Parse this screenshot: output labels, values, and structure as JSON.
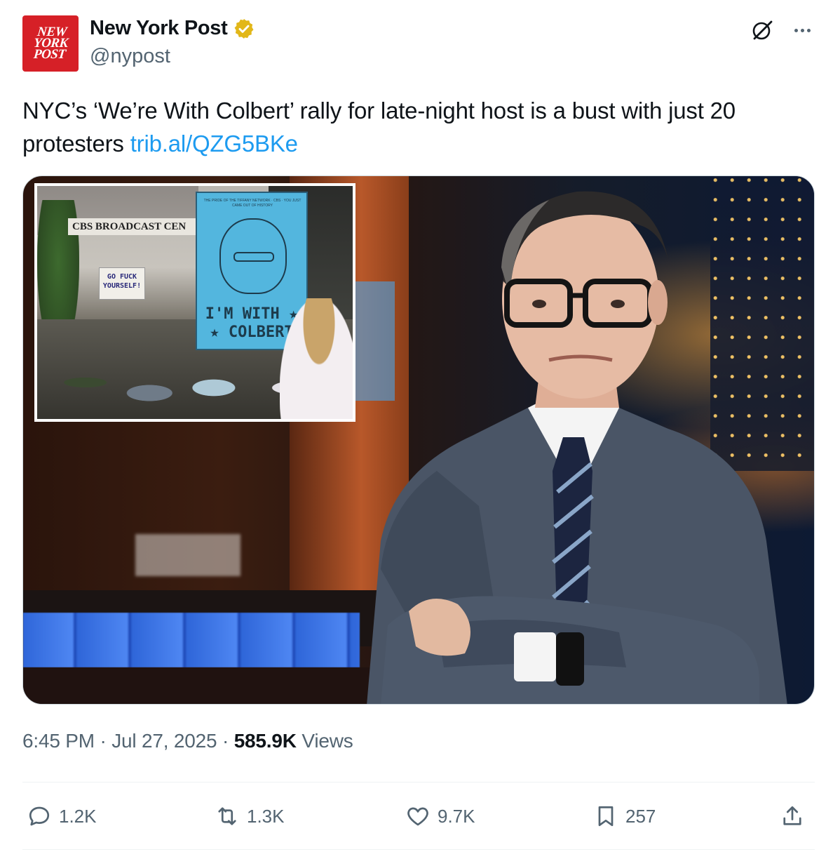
{
  "account": {
    "display_name": "New York Post",
    "handle": "@nypost",
    "avatar_logo_lines": [
      "NEW",
      "YORK",
      "POST"
    ],
    "verified_badge": "gold-verified-icon",
    "brand_color": "#d62027"
  },
  "tweet": {
    "text": "NYC’s ‘We’re With Colbert’ rally for late-night host is a bust with just 20 protesters ",
    "link": "trib.al/QZG5BKe",
    "link_color": "#1d9bf0"
  },
  "media": {
    "inset_sign_building": "CBS BROADCAST CEN",
    "inset_sign_small": [
      "GO FUCK",
      "YOURSELF!"
    ],
    "inset_sign_big": [
      "I'M WITH ★",
      "★ COLBERT"
    ],
    "inset_sign_big_header": "THE PRIDE OF THE TIFFANY NETWORK · CBS · YOU JUST CAME OUT OF HISTORY"
  },
  "meta": {
    "time": "6:45 PM",
    "date": "Jul 27, 2025",
    "views_count": "585.9K",
    "views_label": "Views",
    "separator": "·"
  },
  "actions": {
    "replies": "1.2K",
    "reposts": "1.3K",
    "likes": "9.7K",
    "bookmarks": "257"
  },
  "colors": {
    "text": "#0f1419",
    "secondary": "#536471",
    "accent": "#1d9bf0"
  }
}
